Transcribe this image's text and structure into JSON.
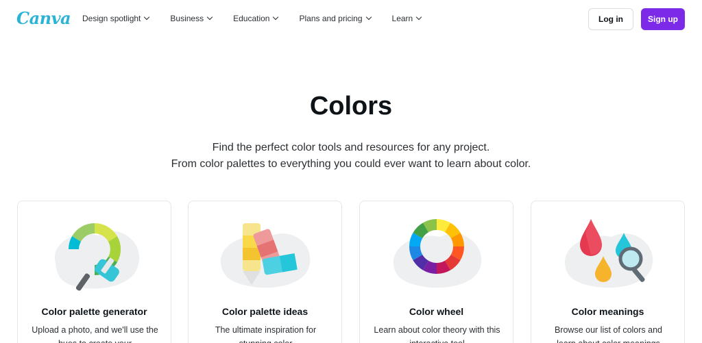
{
  "header": {
    "logo_text": "Canva",
    "nav": [
      {
        "label": "Design spotlight"
      },
      {
        "label": "Business"
      },
      {
        "label": "Education"
      },
      {
        "label": "Plans and pricing"
      },
      {
        "label": "Learn"
      }
    ],
    "login_label": "Log in",
    "signup_label": "Sign up"
  },
  "hero": {
    "title": "Colors",
    "subtitle_line1": "Find the perfect color tools and resources for any project.",
    "subtitle_line2": "From color palettes to everything you could ever want to learn about color."
  },
  "cards": [
    {
      "title": "Color palette generator",
      "desc": "Upload a photo, and we'll use the hues to create your",
      "icon": "paint-roller-icon"
    },
    {
      "title": "Color palette ideas",
      "desc": "The ultimate inspiration for stunning color",
      "icon": "swatches-icon"
    },
    {
      "title": "Color wheel",
      "desc": "Learn about color theory with this interactive tool",
      "icon": "color-wheel-icon"
    },
    {
      "title": "Color meanings",
      "desc": "Browse our list of colors and learn about color meanings",
      "icon": "drops-magnifier-icon"
    }
  ],
  "colors": {
    "brand_purple": "#7d2ae8",
    "logo_teal": "#1fb6d3"
  }
}
